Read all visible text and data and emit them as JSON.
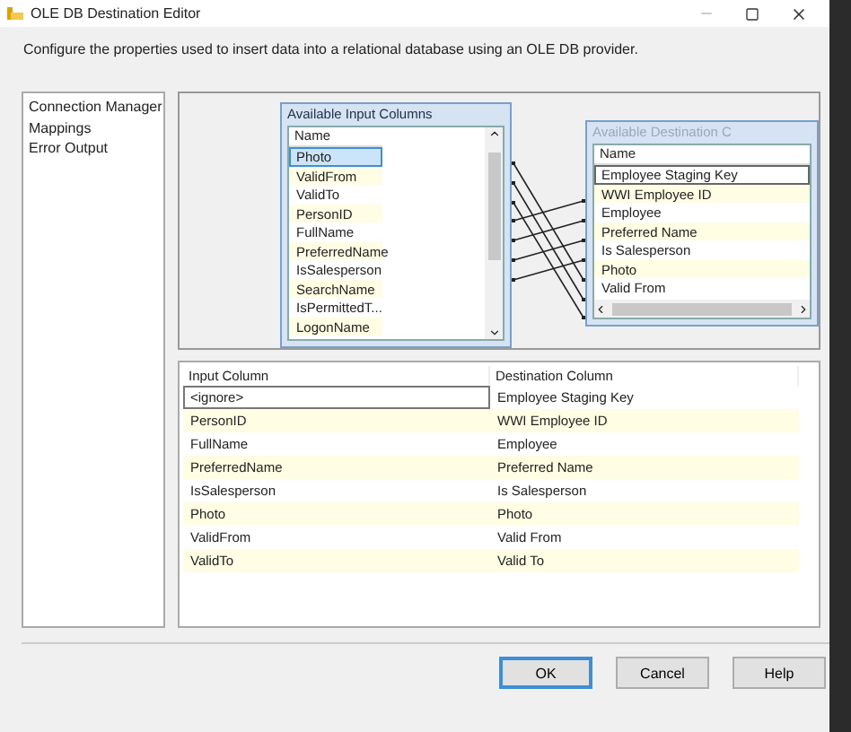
{
  "window": {
    "title": "OLE DB Destination Editor"
  },
  "description": "Configure the properties used to insert data into a relational database using an OLE DB provider.",
  "nav": [
    {
      "label": "Connection Manager"
    },
    {
      "label": "Mappings"
    },
    {
      "label": "Error Output"
    }
  ],
  "input_columns": {
    "title": "Available Input Columns",
    "header": "Name",
    "items": [
      {
        "name": "Photo",
        "selected": true
      },
      {
        "name": "ValidFrom",
        "selected": false
      },
      {
        "name": "ValidTo",
        "selected": false
      },
      {
        "name": "PersonID",
        "selected": false
      },
      {
        "name": "FullName",
        "selected": false
      },
      {
        "name": "PreferredName",
        "selected": false
      },
      {
        "name": "IsSalesperson",
        "selected": false
      },
      {
        "name": "SearchName",
        "selected": false
      },
      {
        "name": "IsPermittedT...",
        "selected": false
      },
      {
        "name": "LogonName",
        "selected": false
      }
    ]
  },
  "destination_columns": {
    "title": "Available Destination C",
    "header": "Name",
    "items": [
      {
        "name": "Employee Staging Key",
        "focused": true
      },
      {
        "name": "WWI Employee ID",
        "focused": false
      },
      {
        "name": "Employee",
        "focused": false
      },
      {
        "name": "Preferred Name",
        "focused": false
      },
      {
        "name": "Is Salesperson",
        "focused": false
      },
      {
        "name": "Photo",
        "focused": false
      },
      {
        "name": "Valid From",
        "focused": false
      }
    ]
  },
  "mapping_grid": {
    "columns": [
      "Input Column",
      "Destination Column"
    ],
    "rows": [
      {
        "input": "<ignore>",
        "destination": "Employee Staging Key",
        "editing": true
      },
      {
        "input": "PersonID",
        "destination": "WWI Employee ID",
        "editing": false
      },
      {
        "input": "FullName",
        "destination": "Employee",
        "editing": false
      },
      {
        "input": "PreferredName",
        "destination": "Preferred Name",
        "editing": false
      },
      {
        "input": "IsSalesperson",
        "destination": "Is Salesperson",
        "editing": false
      },
      {
        "input": "Photo",
        "destination": "Photo",
        "editing": false
      },
      {
        "input": "ValidFrom",
        "destination": "Valid From",
        "editing": false
      },
      {
        "input": "ValidTo",
        "destination": "Valid To",
        "editing": false
      }
    ]
  },
  "buttons": [
    {
      "label": "OK",
      "default": true
    },
    {
      "label": "Cancel",
      "default": false
    },
    {
      "label": "Help",
      "default": false
    }
  ]
}
